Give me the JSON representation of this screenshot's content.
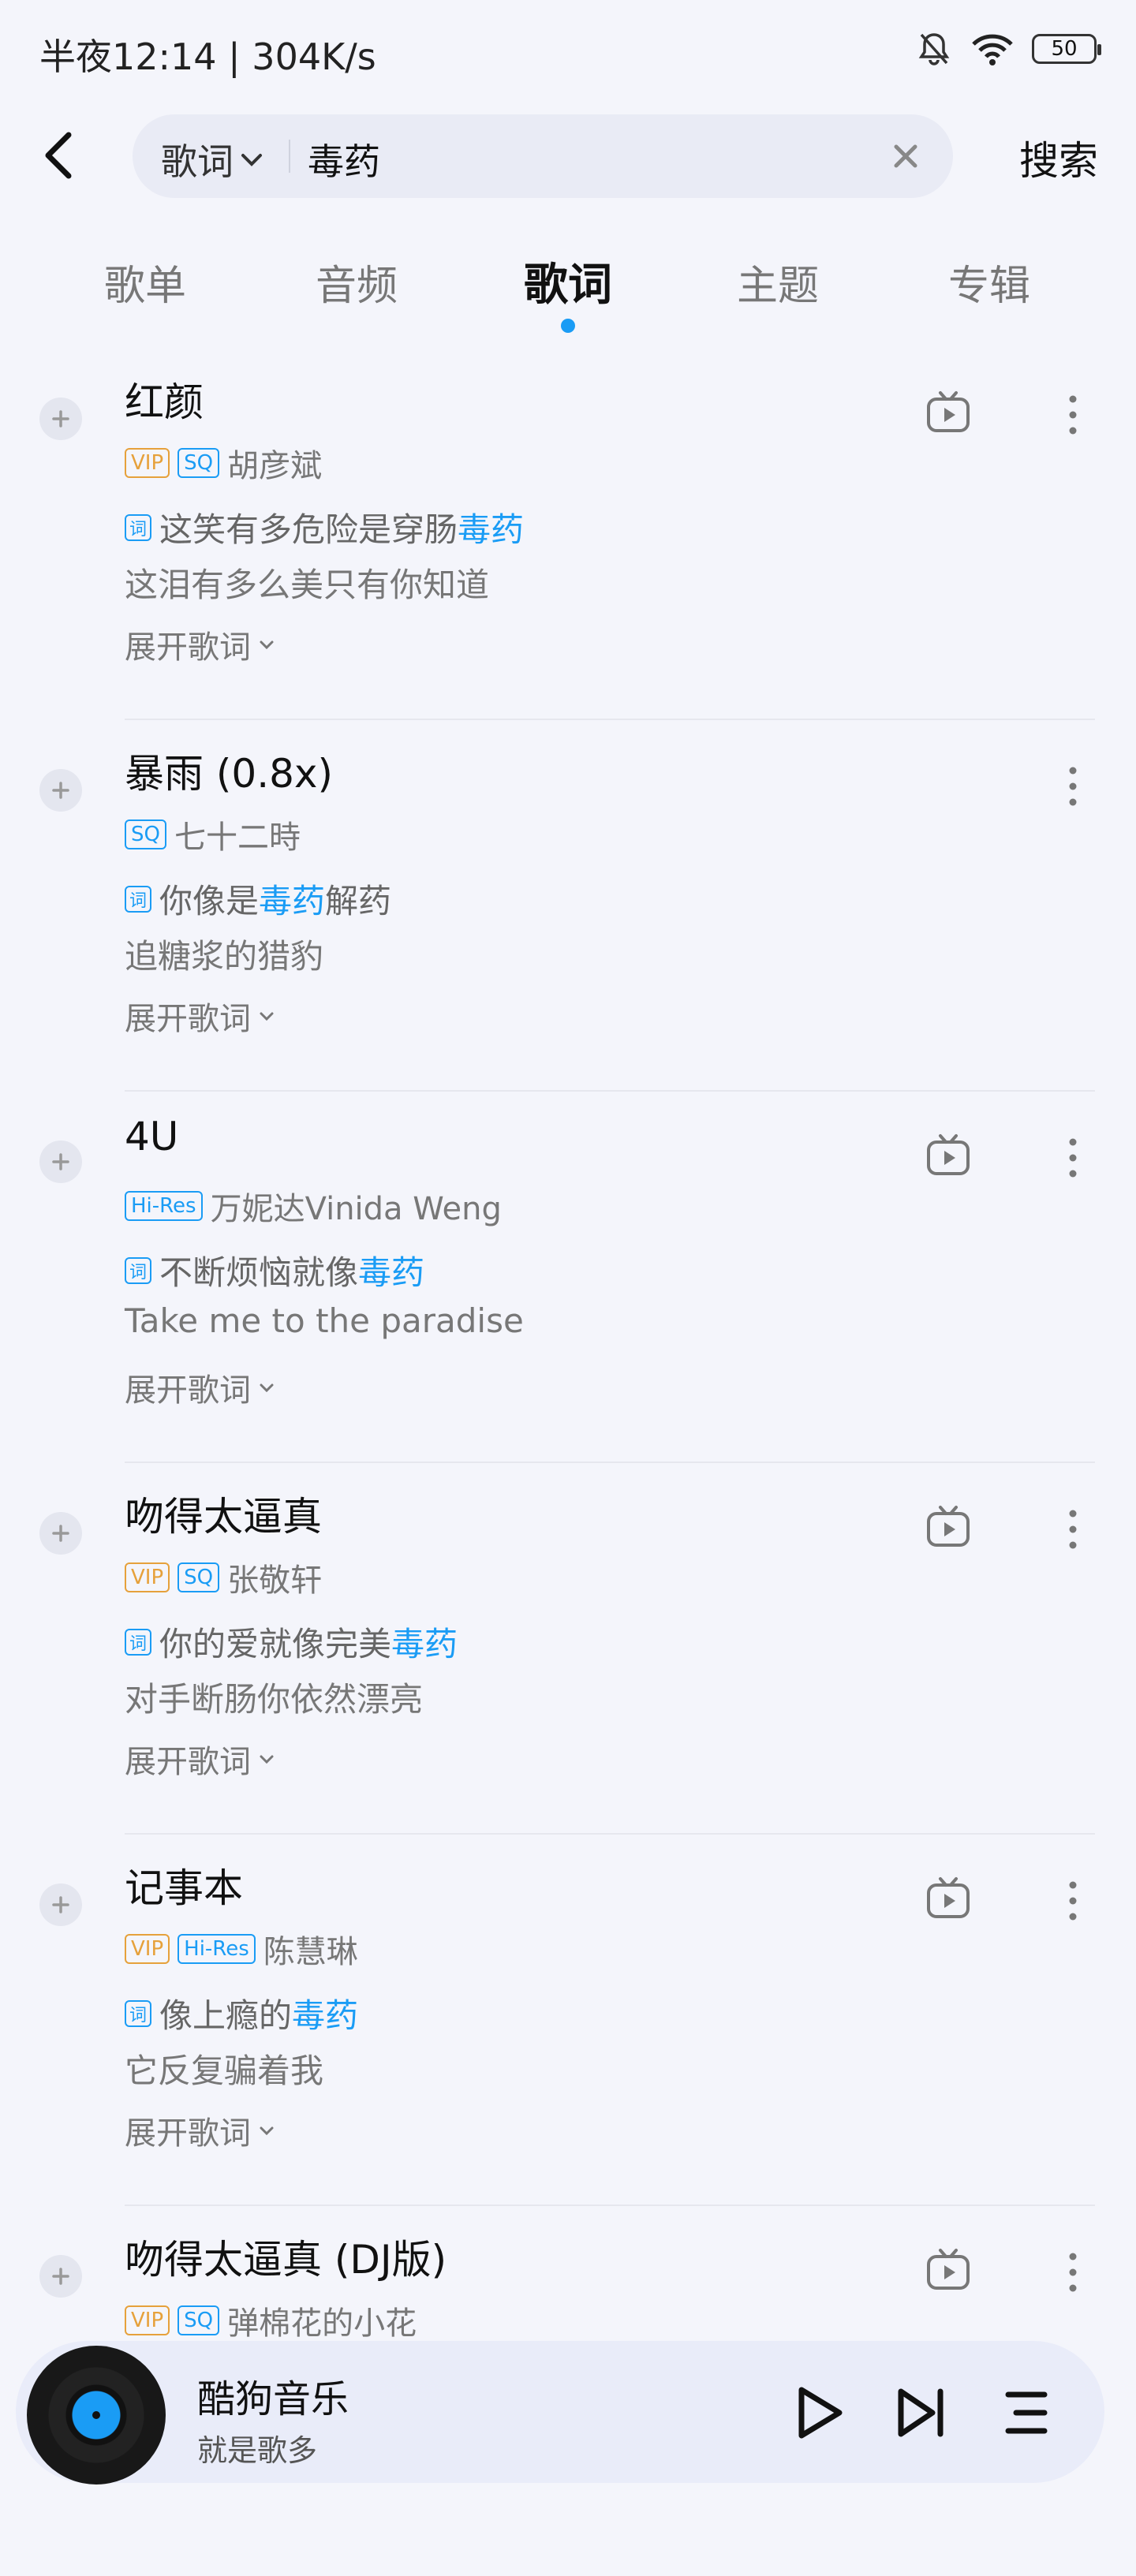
{
  "status": {
    "time": "半夜12:14 | 304K/s",
    "battery": "50"
  },
  "search": {
    "scope": "歌词",
    "query": "毒药",
    "submit": "搜索"
  },
  "tabs": [
    {
      "label": "歌单",
      "active": false
    },
    {
      "label": "音频",
      "active": false
    },
    {
      "label": "歌词",
      "active": true
    },
    {
      "label": "主题",
      "active": false
    },
    {
      "label": "专辑",
      "active": false
    }
  ],
  "results": [
    {
      "title": "红颜",
      "badges": [
        "VIP",
        "SQ"
      ],
      "artist": "胡彦斌",
      "lyric_prefix": "这笑有多危险是穿肠",
      "lyric_hl": "毒药",
      "lyric_suffix": "",
      "lyric_next": "这泪有多么美只有你知道",
      "expand": "展开歌词",
      "has_mv": true
    },
    {
      "title": "暴雨 (0.8x)",
      "badges": [
        "SQ"
      ],
      "artist": "七十二時",
      "lyric_prefix": "你像是",
      "lyric_hl": "毒药",
      "lyric_suffix": "解药",
      "lyric_next": "追糖浆的猎豹",
      "expand": "展开歌词",
      "has_mv": false
    },
    {
      "title": "4U",
      "badges": [
        "Hi-Res"
      ],
      "artist": "万妮达Vinida Weng",
      "lyric_prefix": "不断烦恼就像",
      "lyric_hl": "毒药",
      "lyric_suffix": "",
      "lyric_next": "Take me to the paradise",
      "expand": "展开歌词",
      "has_mv": true
    },
    {
      "title": "吻得太逼真",
      "badges": [
        "VIP",
        "SQ"
      ],
      "artist": "张敬轩",
      "lyric_prefix": "你的爱就像完美",
      "lyric_hl": "毒药",
      "lyric_suffix": "",
      "lyric_next": "对手断肠你依然漂亮",
      "expand": "展开歌词",
      "has_mv": true
    },
    {
      "title": "记事本",
      "badges": [
        "VIP",
        "Hi-Res"
      ],
      "artist": "陈慧琳",
      "lyric_prefix": "像上瘾的",
      "lyric_hl": "毒药",
      "lyric_suffix": "",
      "lyric_next": "它反复骗着我",
      "expand": "展开歌词",
      "has_mv": true
    },
    {
      "title": "吻得太逼真 (DJ版)",
      "badges": [
        "VIP",
        "SQ"
      ],
      "artist": "弹棉花的小花",
      "lyric_prefix": "",
      "lyric_hl": "",
      "lyric_suffix": "",
      "lyric_next": "",
      "expand": "",
      "has_mv": true
    }
  ],
  "player": {
    "title": "酷狗音乐",
    "subtitle": "就是歌多"
  },
  "colors": {
    "accent": "#1a9cf5",
    "vip": "#e6a13b",
    "background": "#f4f5fb"
  }
}
